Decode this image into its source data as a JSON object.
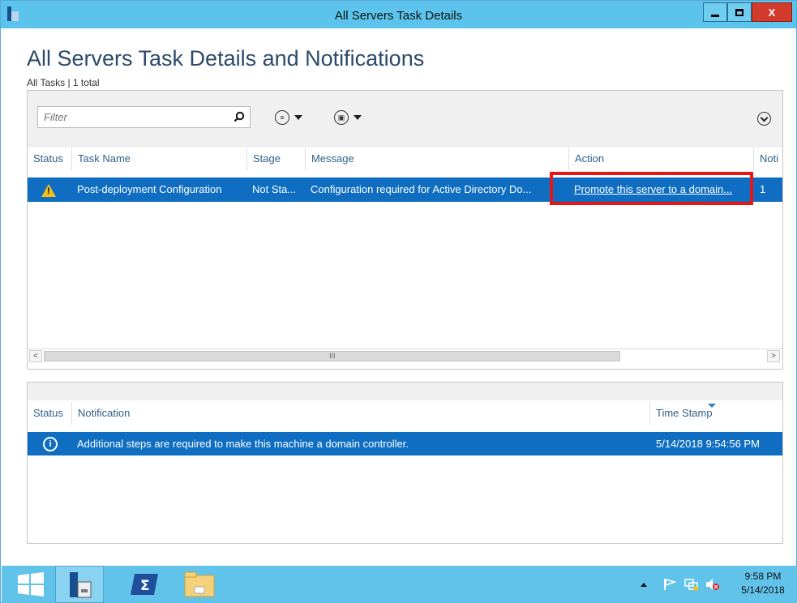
{
  "window": {
    "title": "All Servers Task Details",
    "controls": {
      "minimize": "minimize",
      "maximize": "restore",
      "close": "X"
    }
  },
  "page": {
    "heading": "All Servers Task Details and Notifications",
    "subline": "All Tasks | 1 total"
  },
  "tasks_panel": {
    "filter": {
      "placeholder": "Filter",
      "value": ""
    },
    "toolbar_icons": [
      "search-icon",
      "list-options-icon",
      "save-query-icon",
      "collapse-icon"
    ],
    "columns": [
      "Status",
      "Task Name",
      "Stage",
      "Message",
      "Action",
      "Noti"
    ],
    "rows": [
      {
        "status_icon": "warning-icon",
        "task_name": "Post-deployment Configuration",
        "stage": "Not Sta...",
        "message": "Configuration required for Active Directory Do...",
        "action": "Promote this server to a domain...",
        "notifications": "1"
      }
    ],
    "scrollbar": {
      "left": "<",
      "right": ">",
      "grip": "III"
    }
  },
  "notifications_panel": {
    "columns": [
      "Status",
      "Notification",
      "Time Stamp"
    ],
    "rows": [
      {
        "status_icon": "info-icon",
        "notification": "Additional steps are required to make this machine a domain controller.",
        "timestamp": "5/14/2018 9:54:56 PM"
      }
    ]
  },
  "taskbar": {
    "items": [
      "start-button",
      "server-manager",
      "powershell",
      "file-explorer"
    ],
    "clock": {
      "time": "9:58 PM",
      "date": "5/14/2018"
    }
  },
  "colors": {
    "titlebar": "#5cc4ec",
    "selection": "#0f6ec1",
    "heading": "#2c4a6b",
    "highlight": "#e51616",
    "taskbar": "#62c3ea"
  }
}
